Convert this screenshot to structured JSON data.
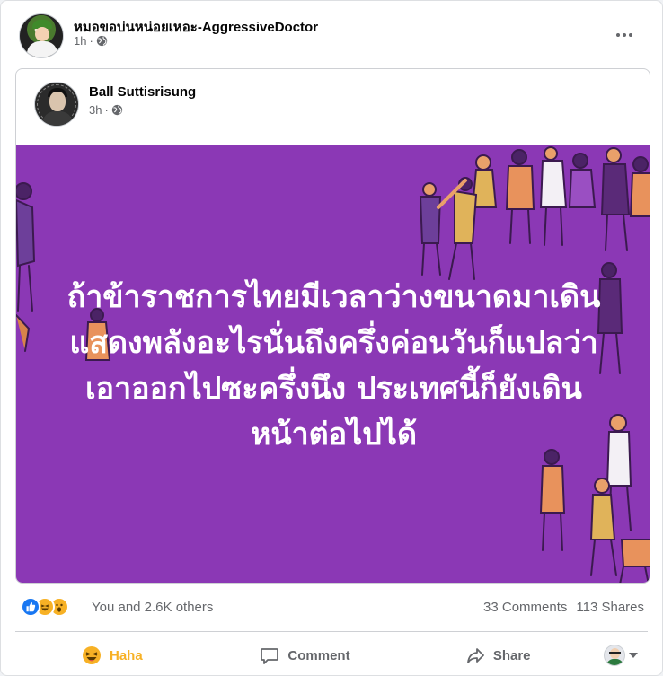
{
  "post": {
    "author": "หมอขอบ่นหน่อยเหอะ-AggressiveDoctor",
    "time": "1h",
    "separator": "·",
    "privacy_icon": "globe-icon",
    "more_icon": "more-options-icon"
  },
  "shared_post": {
    "author": "Ball Suttisrisung",
    "time": "3h",
    "separator": "·",
    "privacy_icon": "globe-icon",
    "background_color": "#8b38b5",
    "text_lines": [
      "ถ้าข้าราชการไทยมีเวลาว่างขนาดมาเดิน",
      "แสดงพลังอะไรนั่นถึงครึ่งค่อนวันก็แปลว่า",
      "เอาออกไปซะครึ่งนึง ประเทศนี้ก็ยังเดิน",
      "หน้าต่อไปได้"
    ]
  },
  "stats": {
    "reaction_icons": [
      "like-icon",
      "haha-icon",
      "wow-icon"
    ],
    "reactions_text": "You and 2.6K others",
    "comments": "33 Comments",
    "shares": "113 Shares"
  },
  "actions": {
    "reaction_label": "Haha",
    "reaction_color": "#f7b125",
    "comment_label": "Comment",
    "share_label": "Share"
  },
  "colors": {
    "secondary_text": "#65676b",
    "like_blue": "#1877f2"
  }
}
